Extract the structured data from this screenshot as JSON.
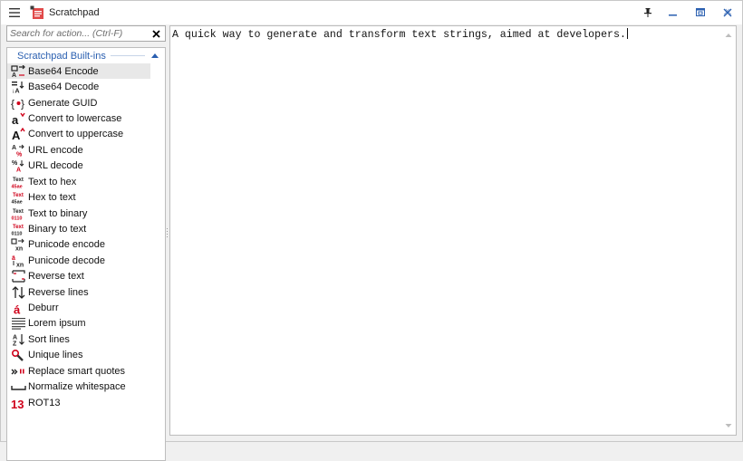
{
  "app": {
    "title": "Scratchpad"
  },
  "search": {
    "placeholder": "Search for action... (Ctrl-F)",
    "value": ""
  },
  "group": {
    "label": "Scratchpad Built-ins"
  },
  "actions": [
    {
      "label": "Base64 Encode",
      "icon": "base64-encode-icon"
    },
    {
      "label": "Base64 Decode",
      "icon": "base64-decode-icon"
    },
    {
      "label": "Generate GUID",
      "icon": "guid-icon"
    },
    {
      "label": "Convert to lowercase",
      "icon": "lowercase-icon"
    },
    {
      "label": "Convert to uppercase",
      "icon": "uppercase-icon"
    },
    {
      "label": "URL encode",
      "icon": "url-encode-icon"
    },
    {
      "label": "URL decode",
      "icon": "url-decode-icon"
    },
    {
      "label": "Text to hex",
      "icon": "text-to-hex-icon"
    },
    {
      "label": "Hex to text",
      "icon": "hex-to-text-icon"
    },
    {
      "label": "Text to binary",
      "icon": "text-to-binary-icon"
    },
    {
      "label": "Binary to text",
      "icon": "binary-to-text-icon"
    },
    {
      "label": "Punicode encode",
      "icon": "punicode-encode-icon"
    },
    {
      "label": "Punicode decode",
      "icon": "punicode-decode-icon"
    },
    {
      "label": "Reverse text",
      "icon": "reverse-text-icon"
    },
    {
      "label": "Reverse lines",
      "icon": "reverse-lines-icon"
    },
    {
      "label": "Deburr",
      "icon": "deburr-icon"
    },
    {
      "label": "Lorem ipsum",
      "icon": "lorem-ipsum-icon"
    },
    {
      "label": "Sort lines",
      "icon": "sort-lines-icon"
    },
    {
      "label": "Unique lines",
      "icon": "unique-lines-icon"
    },
    {
      "label": "Replace smart quotes",
      "icon": "smart-quotes-icon"
    },
    {
      "label": "Normalize whitespace",
      "icon": "whitespace-icon"
    },
    {
      "label": "ROT13",
      "icon": "rot13-icon"
    }
  ],
  "editor": {
    "text": "A quick way to generate and transform text strings, aimed at developers."
  },
  "colors": {
    "accent": "#2a5fb0",
    "icon_red": "#d0021b",
    "selected_row": "#e8e8e8"
  }
}
